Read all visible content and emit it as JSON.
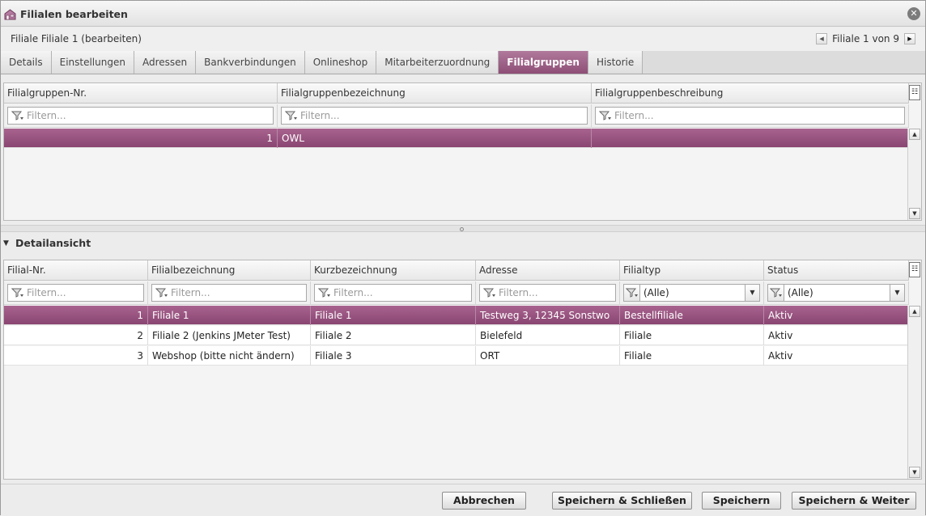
{
  "window": {
    "title": "Filialen bearbeiten"
  },
  "record": {
    "label": "Filiale Filiale 1 (bearbeiten)"
  },
  "pager": {
    "text": "Filiale 1 von 9"
  },
  "tabs": [
    {
      "label": "Details"
    },
    {
      "label": "Einstellungen"
    },
    {
      "label": "Adressen"
    },
    {
      "label": "Bankverbindungen"
    },
    {
      "label": "Onlineshop"
    },
    {
      "label": "Mitarbeiterzuordnung"
    },
    {
      "label": "Filialgruppen",
      "active": true
    },
    {
      "label": "Historie"
    }
  ],
  "groups": {
    "columns": [
      "Filialgruppen-Nr.",
      "Filialgruppenbezeichnung",
      "Filialgruppenbeschreibung"
    ],
    "filter_placeholder": "Filtern...",
    "rows": [
      {
        "nr": "1",
        "name": "OWL",
        "desc": ""
      }
    ]
  },
  "detail": {
    "title": "Detailansicht",
    "columns": [
      "Filial-Nr.",
      "Filialbezeichnung",
      "Kurzbezeichnung",
      "Adresse",
      "Filialtyp",
      "Status"
    ],
    "filter_placeholder": "Filtern...",
    "filter_all": "(Alle)",
    "rows": [
      {
        "nr": "1",
        "name": "Filiale 1",
        "short": "Filiale 1",
        "addr": "Testweg 3, 12345 Sonstwo",
        "type": "Bestellfiliale",
        "status": "Aktiv"
      },
      {
        "nr": "2",
        "name": "Filiale 2 (Jenkins JMeter Test)",
        "short": "Filiale 2",
        "addr": "Bielefeld",
        "type": "Filiale",
        "status": "Aktiv"
      },
      {
        "nr": "3",
        "name": "Webshop (bitte nicht ändern)",
        "short": "Filiale 3",
        "addr": "ORT",
        "type": "Filiale",
        "status": "Aktiv"
      }
    ]
  },
  "buttons": {
    "cancel": "Abbrechen",
    "save_close": "Speichern & Schließen",
    "save": "Speichern",
    "save_next": "Speichern & Weiter"
  },
  "colors": {
    "accent": "#8e4e76",
    "accent_light": "#b07a9c"
  }
}
